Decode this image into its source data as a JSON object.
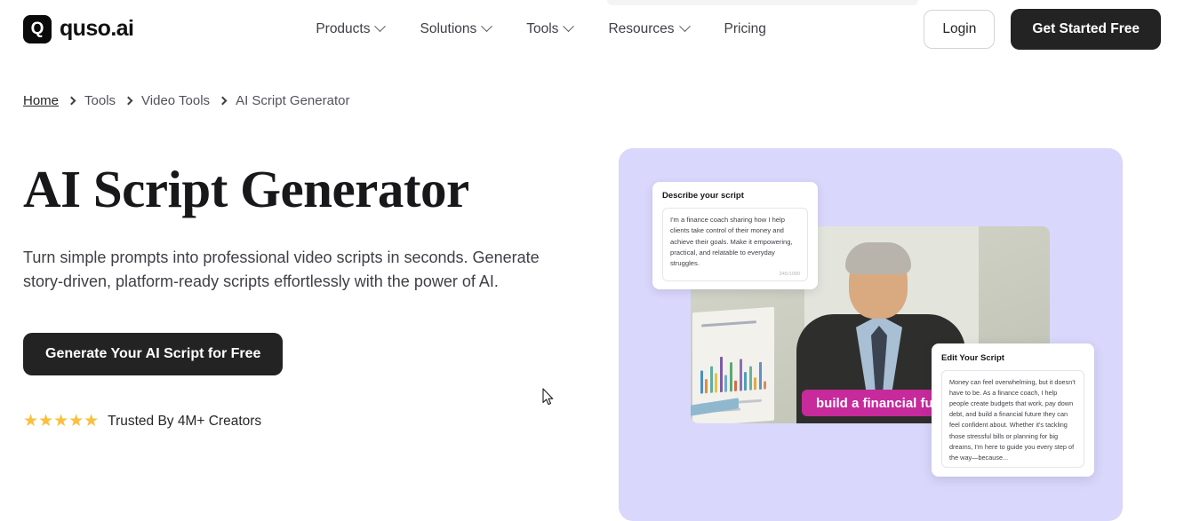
{
  "header": {
    "logo_text": "quso.ai",
    "logo_glyph": "Q",
    "nav": [
      {
        "label": "Products",
        "has_dropdown": true
      },
      {
        "label": "Solutions",
        "has_dropdown": true
      },
      {
        "label": "Tools",
        "has_dropdown": true
      },
      {
        "label": "Resources",
        "has_dropdown": true
      },
      {
        "label": "Pricing",
        "has_dropdown": false
      }
    ],
    "login_label": "Login",
    "get_started_label": "Get Started Free"
  },
  "breadcrumb": {
    "items": [
      "Home",
      "Tools",
      "Video Tools",
      "AI Script Generator"
    ],
    "separator": "›"
  },
  "hero": {
    "title": "AI Script Generator",
    "subtitle": "Turn simple prompts into professional video scripts in seconds. Generate story-driven, platform-ready scripts effortlessly with the power of AI.",
    "cta_label": "Generate Your AI Script for Free",
    "stars": "★★★★★",
    "star_color": "#fbbf3c",
    "trust_text": "Trusted By 4M+ Creators",
    "panel_color": "#d9d7fb"
  },
  "preview": {
    "describe_card": {
      "title": "Describe your script",
      "text": "I'm a finance coach sharing how I help clients take control of their money and achieve their goals. Make it empowering, practical, and relatable to everyday struggles.",
      "counter": "245/1000"
    },
    "edit_card": {
      "title": "Edit Your Script",
      "text": "Money can feel overwhelming, but it doesn't have to be. As a finance coach, I help people create budgets that work, pay down debt, and build a financial future they can feel confident about. Whether it's tackling those stressful bills or planning for big dreams, I'm here to guide you every step of the way—because..."
    },
    "caption": {
      "text": "build a financial future",
      "color": "#c62a9b"
    },
    "chart_bars": [
      {
        "height": 26,
        "color": "#4a8fbf"
      },
      {
        "height": 16,
        "color": "#e28b3c"
      },
      {
        "height": 30,
        "color": "#5fae9e"
      },
      {
        "height": 22,
        "color": "#e2c24a"
      },
      {
        "height": 40,
        "color": "#7d5ba6"
      },
      {
        "height": 19,
        "color": "#6fa8d0"
      },
      {
        "height": 33,
        "color": "#5aa872"
      },
      {
        "height": 12,
        "color": "#d9694a"
      },
      {
        "height": 36,
        "color": "#8d6fb5"
      },
      {
        "height": 21,
        "color": "#4f9fb8"
      },
      {
        "height": 27,
        "color": "#66b39b"
      },
      {
        "height": 14,
        "color": "#e0a84c"
      },
      {
        "height": 31,
        "color": "#5b93c9"
      },
      {
        "height": 9,
        "color": "#d98b5e"
      }
    ]
  }
}
